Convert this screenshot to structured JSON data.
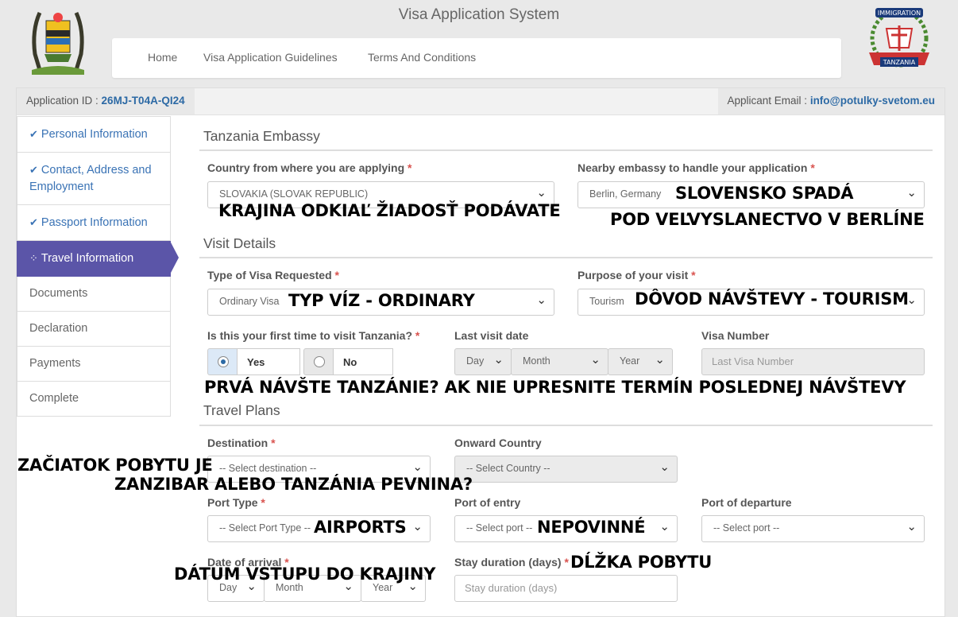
{
  "header": {
    "title": "Visa Application System",
    "nav": [
      "Home",
      "Visa Application Guidelines",
      "Terms And Conditions"
    ],
    "immigration_logo_text": [
      "IMMIGRATION",
      "TANZANIA"
    ]
  },
  "info": {
    "app_id_label": "Application ID : ",
    "app_id": "26MJ-T04A-QI24",
    "email_label": "Applicant Email : ",
    "email": "info@potulky-svetom.eu"
  },
  "sidebar": {
    "items": [
      {
        "label": "Personal Information",
        "state": "done"
      },
      {
        "label": "Contact, Address and Employment",
        "state": "done"
      },
      {
        "label": "Passport Information",
        "state": "done"
      },
      {
        "label": "Travel Information",
        "state": "active"
      },
      {
        "label": "Documents",
        "state": "pending"
      },
      {
        "label": "Declaration",
        "state": "pending"
      },
      {
        "label": "Payments",
        "state": "pending"
      },
      {
        "label": "Complete",
        "state": "pending"
      }
    ]
  },
  "sections": {
    "embassy": "Tanzania Embassy",
    "visit": "Visit Details",
    "travel": "Travel Plans"
  },
  "fields": {
    "country_label": "Country from where you are applying",
    "country_value": "SLOVAKIA (SLOVAK REPUBLIC)",
    "embassy_label": "Nearby embassy to handle your application",
    "embassy_value": "Berlin, Germany",
    "visa_type_label": "Type of Visa Requested",
    "visa_type_value": "Ordinary Visa",
    "purpose_label": "Purpose of your visit",
    "purpose_value": "Tourism",
    "first_time_label": "Is this your first time to visit Tanzania?",
    "yes": "Yes",
    "no": "No",
    "last_visit_label": "Last visit date",
    "day": "Day",
    "month": "Month",
    "year": "Year",
    "visa_number_label": "Visa Number",
    "visa_number_placeholder": "Last Visa Number",
    "destination_label": "Destination",
    "destination_value": "-- Select destination --",
    "onward_label": "Onward Country",
    "onward_value": "-- Select Country --",
    "port_type_label": "Port Type",
    "port_type_value": "-- Select Port Type --",
    "port_entry_label": "Port of entry",
    "port_entry_value": "-- Select port --",
    "port_departure_label": "Port of departure",
    "port_departure_value": "-- Select port --",
    "arrival_label": "Date of arrival",
    "stay_label": "Stay duration (days)",
    "stay_placeholder": "Stay duration (days)",
    "required_mark": "*"
  },
  "annotations": {
    "country": "KRAJINA ODKIAĽ ŽIADOSŤ PODÁVATE",
    "embassy_1": "SLOVENSKO SPADÁ",
    "embassy_2": "POD VEĽVYSLANECTVO V BERLÍNE",
    "visa_type": "TYP VÍZ - ORDINARY",
    "purpose": "DÔVOD NÁVŠTEVY - TOURISM",
    "first_visit": "PRVÁ NÁVŠTE TANZÁNIE? AK NIE UPRESNITE TERMÍN POSLEDNEJ NÁVŠTEVY",
    "destination_1": "ZAČIATOK POBYTU JE",
    "destination_2": "ZANZIBAR ALEBO TANZÁNIA PEVNINA?",
    "port_type": "AIRPORTS",
    "port_entry": "NEPOVINNÉ",
    "arrival": "DÁTUM VSTUPU DO KRAJINY",
    "stay": "DĹŽKA POBYTU"
  },
  "colors": {
    "accent": "#5b55a8",
    "link": "#2d6aa5",
    "required": "#d9534f"
  }
}
